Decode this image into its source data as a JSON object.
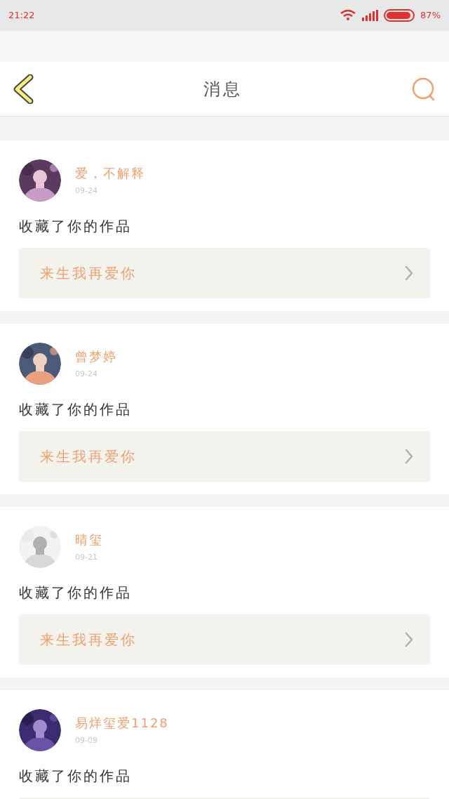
{
  "status_bar": {
    "time": "21:22",
    "battery": "87%"
  },
  "header": {
    "title": "消息"
  },
  "messages": [
    {
      "user": "爱，不解释",
      "date": "09-24",
      "text": "收藏了你的作品",
      "work": "来生我再爱你"
    },
    {
      "user": "曾梦婷",
      "date": "09-24",
      "text": "收藏了你的作品",
      "work": "来生我再爱你"
    },
    {
      "user": "晴玺",
      "date": "09-21",
      "text": "收藏了你的作品",
      "work": "来生我再爱你"
    },
    {
      "user": "易烊玺爱1128",
      "date": "09-09",
      "text": "收藏了你的作品"
    }
  ]
}
